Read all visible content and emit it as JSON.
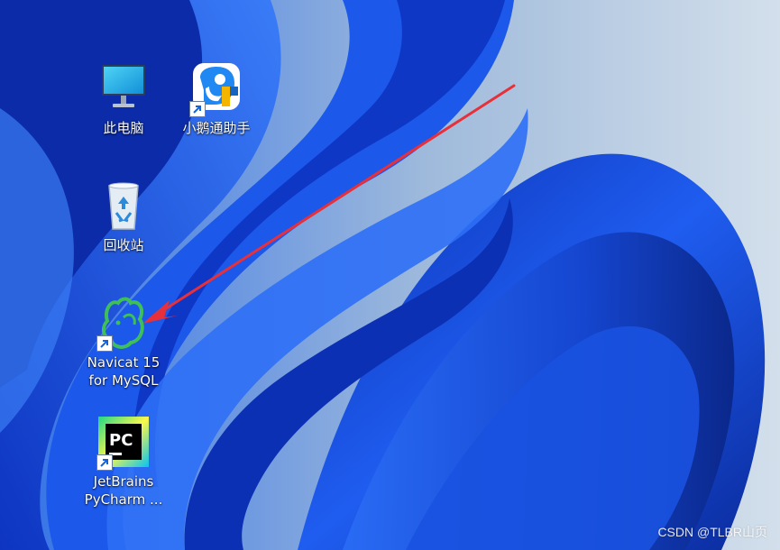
{
  "desktop": {
    "icons": [
      {
        "label": "此电脑",
        "icon": "monitor-icon"
      },
      {
        "label": "小鹅通助手",
        "icon": "xiaoetong-icon",
        "shortcut": true
      },
      {
        "label": "回收站",
        "icon": "recycle-bin-icon"
      },
      {
        "label": "Navicat 15\nfor MySQL",
        "icon": "navicat-icon",
        "shortcut": true
      },
      {
        "label": "JetBrains\nPyCharm ...",
        "icon": "pycharm-icon",
        "shortcut": true
      }
    ],
    "pycharm_logo_text": "PC"
  },
  "watermark": "CSDN @TLBR山页",
  "colors": {
    "wallpaper_light": "#c9d8e8",
    "wallpaper_blue": "#1a4fd6",
    "wallpaper_deep": "#0a2a9c",
    "arrow": "#e8303a",
    "navicat_green": "#3fbf5a"
  }
}
